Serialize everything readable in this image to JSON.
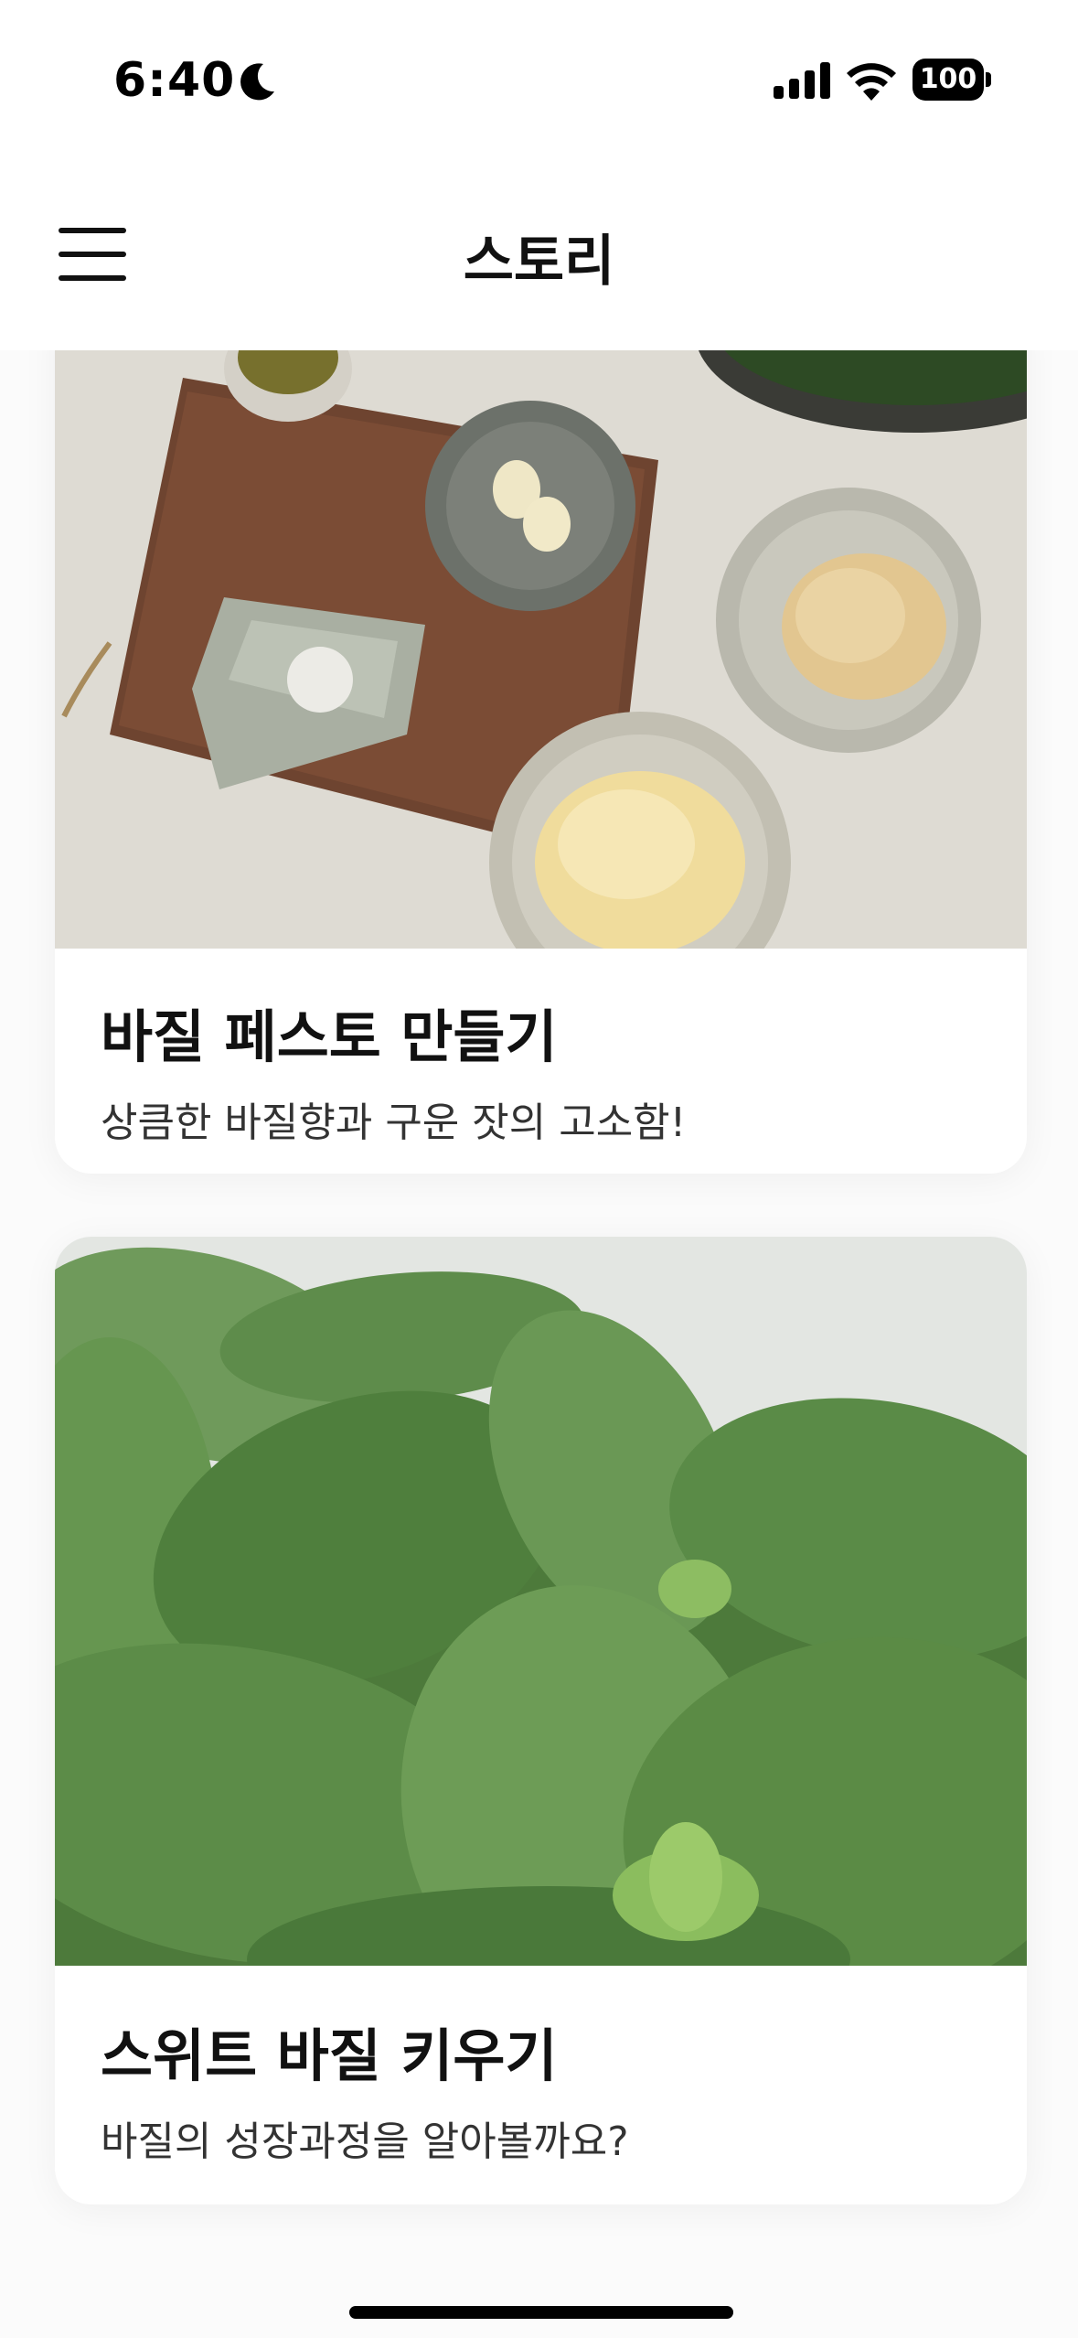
{
  "status_bar": {
    "time": "6:40",
    "battery": "100",
    "icons": [
      "moon-icon",
      "signal-icon",
      "wifi-icon",
      "battery-icon"
    ]
  },
  "nav": {
    "title": "스토리",
    "menu_icon": "hamburger-menu-icon"
  },
  "stories": [
    {
      "title": "바질 페스토 만들기",
      "subtitle": "상큼한 바질향과 구운 잣의 고소함!",
      "image": "pesto-ingredients-photo"
    },
    {
      "title": "스위트 바질 키우기",
      "subtitle": "바질의 성장과정을 알아볼까요?",
      "image": "sweet-basil-plant-photo"
    }
  ],
  "colors": {
    "background": "#fbfbfb",
    "card": "#ffffff",
    "text": "#111111"
  }
}
